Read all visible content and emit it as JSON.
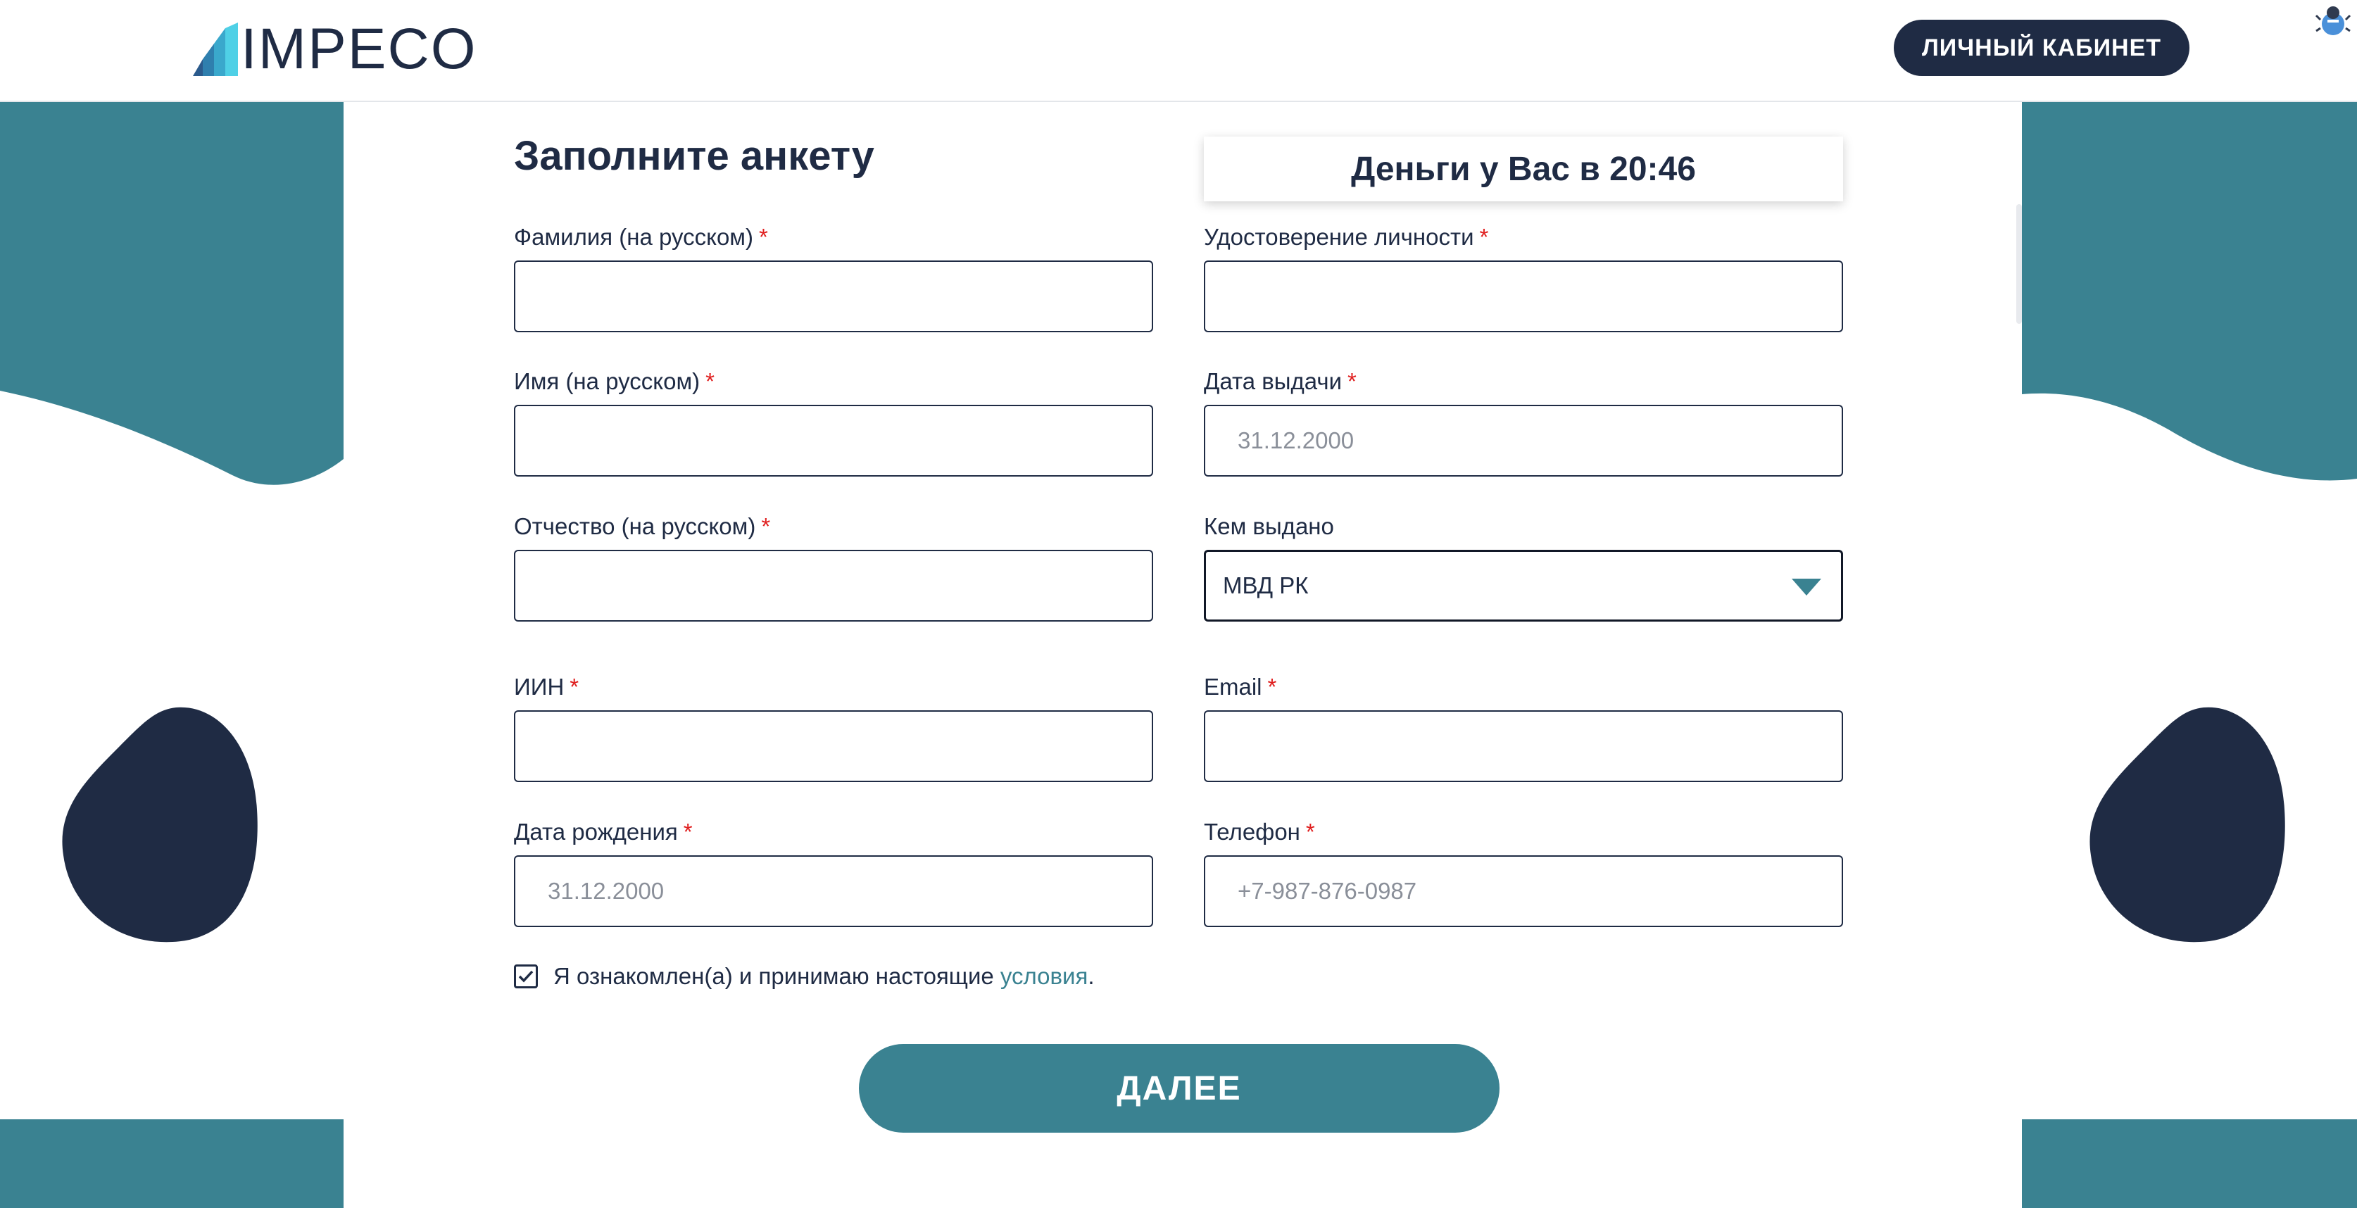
{
  "header": {
    "logo_text": "IMPECO",
    "cabinet_button": "ЛИЧНЫЙ КАБИНЕТ"
  },
  "form": {
    "title": "Заполните анкету",
    "timer": "Деньги у Вас в 20:46",
    "required_mark": "*",
    "fields": {
      "last_name": {
        "label": "Фамилия (на русском)",
        "value": ""
      },
      "first_name": {
        "label": "Имя (на русском)",
        "value": ""
      },
      "patronymic": {
        "label": "Отчество (на русском)",
        "value": ""
      },
      "iin": {
        "label": "ИИН",
        "value": ""
      },
      "birth_date": {
        "label": "Дата рождения",
        "placeholder": "31.12.2000"
      },
      "id_card": {
        "label": "Удостоверение личности",
        "value": ""
      },
      "issue_date": {
        "label": "Дата выдачи",
        "placeholder": "31.12.2000"
      },
      "issued_by": {
        "label": "Кем выдано",
        "selected": "МВД РК"
      },
      "email": {
        "label": "Email",
        "value": ""
      },
      "phone": {
        "label": "Телефон",
        "placeholder": "+7-987-876-0987"
      }
    },
    "consent": {
      "checked": true,
      "text": "Я ознакомлен(а) и принимаю настоящие",
      "link": "условия",
      "end": "."
    },
    "next_button": "ДАЛЕЕ"
  },
  "colors": {
    "navy": "#1f2b44",
    "teal": "#3a8291",
    "required": "#e02020"
  }
}
